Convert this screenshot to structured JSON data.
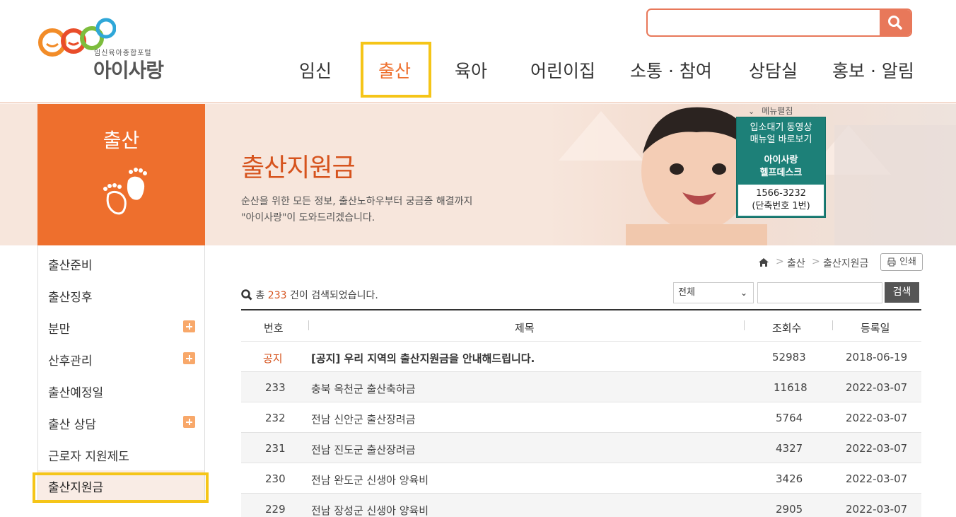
{
  "brand": {
    "logo_sub": "임신육아종합포털",
    "logo_main": "아이사랑",
    "logo_icon": "smile-circles-logo",
    "colors": {
      "accent": "#ee6f2d",
      "accent_dark": "#d6531d",
      "teal": "#1d8078",
      "highlight": "#f5c518"
    }
  },
  "search": {
    "placeholder": "",
    "icon": "search-icon"
  },
  "gnb": {
    "items": [
      {
        "label": "임신"
      },
      {
        "label": "출산",
        "active": true
      },
      {
        "label": "육아"
      },
      {
        "label": "어린이집"
      },
      {
        "label": "소통 · 참여"
      },
      {
        "label": "상담실"
      },
      {
        "label": "홍보 · 알림"
      }
    ]
  },
  "section": {
    "title": "출산",
    "icon": "baby-feet-icon"
  },
  "visual": {
    "title": "출산지원금",
    "desc1": "순산을 위한 모든 정보, 출산노하우부터 궁금증 해결까지",
    "desc2": "\"아이사랑\"이 도와드리겠습니다.",
    "menu_open": "메뉴펼침"
  },
  "helpdesk": {
    "line1a": "입소대기 동영상",
    "line1b": "매뉴얼 바로보기",
    "line2a": "아이사랑",
    "line2b": "헬프데스크",
    "phone": "1566-3232",
    "phone_note": "(단축번호 1번)"
  },
  "lnb": {
    "items": [
      {
        "label": "출산준비",
        "has_sub": false
      },
      {
        "label": "출산징후",
        "has_sub": false
      },
      {
        "label": "분만",
        "has_sub": true
      },
      {
        "label": "산후관리",
        "has_sub": true
      },
      {
        "label": "출산예정일",
        "has_sub": false
      },
      {
        "label": "출산 상담",
        "has_sub": true
      },
      {
        "label": "근로자 지원제도",
        "has_sub": false
      }
    ],
    "active": "출산지원금"
  },
  "breadcrumb": {
    "home_icon": "home-icon",
    "level1": "출산",
    "level2": "출산지원금",
    "sep": ">"
  },
  "print_label": "인쇄",
  "list": {
    "count_prefix": "총",
    "count": "233",
    "count_suffix": "건이 검색되었습니다.",
    "filter_value": "전체",
    "search_button": "검색",
    "headers": {
      "no": "번호",
      "title": "제목",
      "views": "조회수",
      "date": "등록일"
    },
    "rows": [
      {
        "no": "공지",
        "title": "[공지] 우리 지역의 출산지원금을 안내해드립니다.",
        "views": "52983",
        "date": "2018-06-19",
        "notice": true
      },
      {
        "no": "233",
        "title": "충북 옥천군 출산축하금",
        "views": "11618",
        "date": "2022-03-07"
      },
      {
        "no": "232",
        "title": "전남 신안군 출산장려금",
        "views": "5764",
        "date": "2022-03-07"
      },
      {
        "no": "231",
        "title": "전남 진도군 출산장려금",
        "views": "4327",
        "date": "2022-03-07"
      },
      {
        "no": "230",
        "title": "전남 완도군 신생아 양육비",
        "views": "3426",
        "date": "2022-03-07"
      },
      {
        "no": "229",
        "title": "전남 장성군 신생아 양육비",
        "views": "2905",
        "date": "2022-03-07"
      }
    ]
  }
}
